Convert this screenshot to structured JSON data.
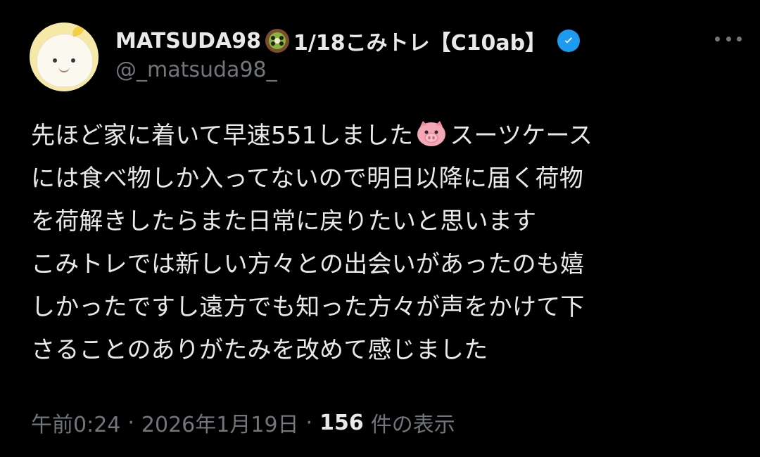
{
  "author": {
    "name_prefix": "MATSUDA98",
    "name_suffix": "1/18こみトレ【C10ab】",
    "handle": "@_matsuda98_",
    "emoji_icon": "kiwi-icon",
    "verified_color": "#1d9bf0"
  },
  "tweet": {
    "lines": [
      "先ほど家に着いて早速551しました",
      "スーツケース",
      "には食べ物しか入ってないので明日以降に届く荷物",
      "を荷解きしたらまた日常に戻りたいと思います",
      "こみトレでは新しい方々との出会いがあったのも嬉",
      "しかったですし遠方でも知った方々が声をかけて下",
      "さることのありがたみを改めて感じました"
    ]
  },
  "meta": {
    "time": "午前0:24",
    "date": "2026年1月19日",
    "views_count": "156",
    "views_label": "件の表示",
    "separator": "·"
  },
  "colors": {
    "background": "#000000",
    "text_primary": "#e7e9ea",
    "text_secondary": "#71767b"
  }
}
